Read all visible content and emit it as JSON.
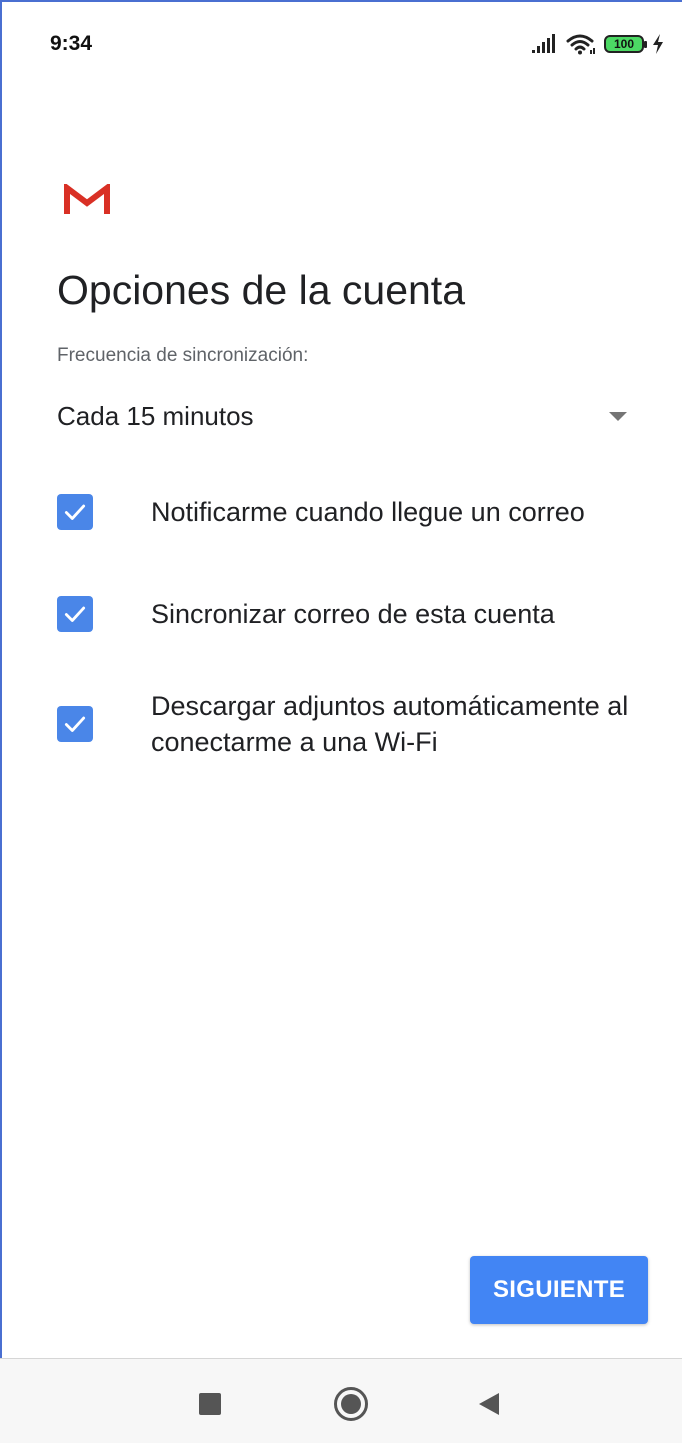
{
  "status_bar": {
    "time": "9:34",
    "battery_level": "100",
    "icons": [
      "signal-icon",
      "wifi-icon",
      "battery-icon",
      "charging-icon"
    ]
  },
  "brand": {
    "logo": "gmail-logo",
    "colors": {
      "red": "#d93025",
      "accent": "#4285f4"
    }
  },
  "page": {
    "title": "Opciones de la cuenta",
    "sync_label": "Frecuencia de sincronización:",
    "sync_value": "Cada 15 minutos"
  },
  "options": [
    {
      "label": "Notificarme cuando llegue un correo",
      "checked": true
    },
    {
      "label": "Sincronizar correo de esta cuenta",
      "checked": true
    },
    {
      "label": "Descargar adjuntos automáticamente al conectarme a una Wi-Fi",
      "checked": true
    }
  ],
  "actions": {
    "next_label": "SIGUIENTE"
  },
  "nav": {
    "icons": [
      "recents-icon",
      "home-icon",
      "back-icon"
    ]
  }
}
